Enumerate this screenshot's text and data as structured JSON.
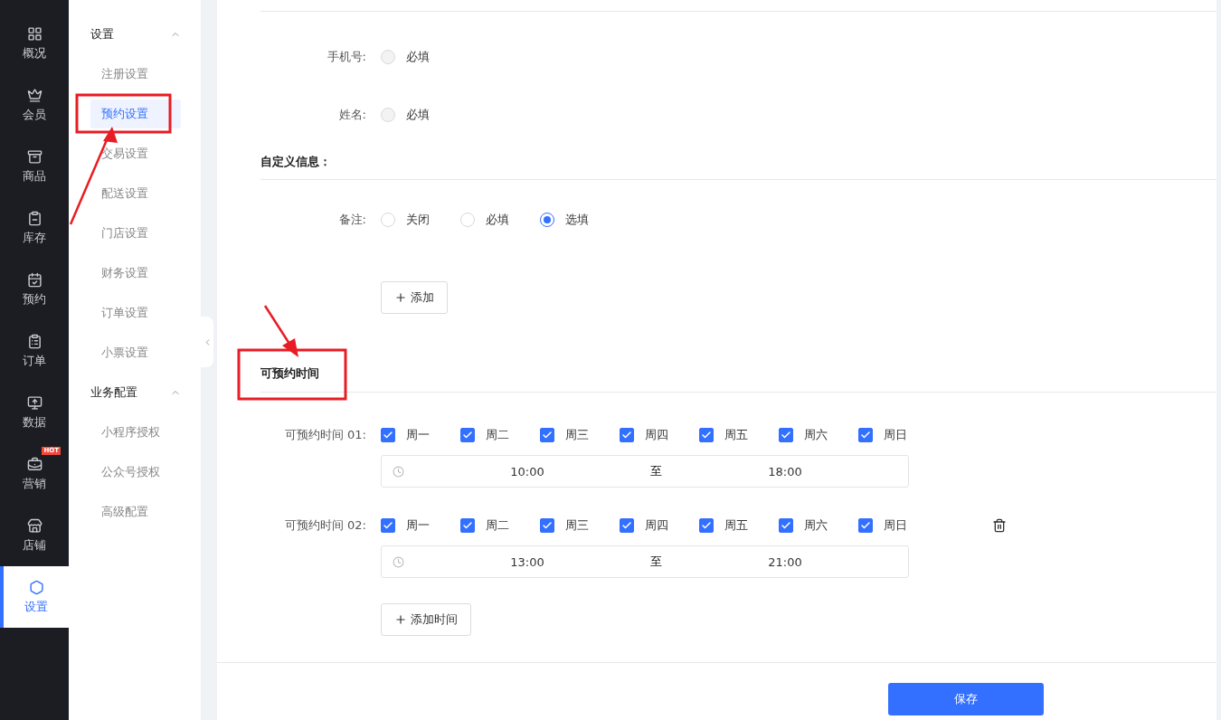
{
  "nav": [
    {
      "label": "概况",
      "selected": false
    },
    {
      "label": "会员",
      "selected": false
    },
    {
      "label": "商品",
      "selected": false
    },
    {
      "label": "库存",
      "selected": false
    },
    {
      "label": "预约",
      "selected": false
    },
    {
      "label": "订单",
      "selected": false
    },
    {
      "label": "数据",
      "selected": false
    },
    {
      "label": "营销",
      "selected": false,
      "badge": "HOT"
    },
    {
      "label": "店铺",
      "selected": false
    },
    {
      "label": "设置",
      "selected": true
    }
  ],
  "submenu": [
    {
      "title": "设置",
      "expanded": true,
      "items": [
        {
          "label": "注册设置",
          "selected": false
        },
        {
          "label": "预约设置",
          "selected": true
        },
        {
          "label": "交易设置",
          "selected": false
        },
        {
          "label": "配送设置",
          "selected": false
        },
        {
          "label": "门店设置",
          "selected": false
        },
        {
          "label": "财务设置",
          "selected": false
        },
        {
          "label": "订单设置",
          "selected": false
        },
        {
          "label": "小票设置",
          "selected": false
        }
      ]
    },
    {
      "title": "业务配置",
      "expanded": true,
      "items": [
        {
          "label": "小程序授权",
          "selected": false
        },
        {
          "label": "公众号授权",
          "selected": false
        },
        {
          "label": "高级配置",
          "selected": false
        }
      ]
    }
  ],
  "fixed_fields": [
    {
      "label": "手机号:",
      "options": [
        {
          "label": "必填",
          "selected": false,
          "disabled": true
        }
      ]
    },
    {
      "label": "姓名:",
      "options": [
        {
          "label": "必填",
          "selected": false,
          "disabled": true
        }
      ]
    }
  ],
  "custom_section": {
    "title": "自定义信息：",
    "fields": [
      {
        "label": "备注:",
        "options": [
          {
            "label": "关闭",
            "selected": false,
            "disabled": false
          },
          {
            "label": "必填",
            "selected": false,
            "disabled": false
          },
          {
            "label": "选填",
            "selected": true,
            "disabled": false
          }
        ]
      }
    ],
    "add_button": "添加"
  },
  "time_section": {
    "title": "可预约时间",
    "slots": [
      {
        "label": "可预约时间 01:",
        "days": [
          {
            "label": "周一",
            "checked": true
          },
          {
            "label": "周二",
            "checked": true
          },
          {
            "label": "周三",
            "checked": true
          },
          {
            "label": "周四",
            "checked": true
          },
          {
            "label": "周五",
            "checked": true
          },
          {
            "label": "周六",
            "checked": true
          },
          {
            "label": "周日",
            "checked": true
          }
        ],
        "start": "10:00",
        "separator": "至",
        "end": "18:00",
        "removable": false
      },
      {
        "label": "可预约时间 02:",
        "days": [
          {
            "label": "周一",
            "checked": true
          },
          {
            "label": "周二",
            "checked": true
          },
          {
            "label": "周三",
            "checked": true
          },
          {
            "label": "周四",
            "checked": true
          },
          {
            "label": "周五",
            "checked": true
          },
          {
            "label": "周六",
            "checked": true
          },
          {
            "label": "周日",
            "checked": true
          }
        ],
        "start": "13:00",
        "separator": "至",
        "end": "21:00",
        "removable": true
      }
    ],
    "add_button": "添加时间"
  },
  "save_button": "保存"
}
